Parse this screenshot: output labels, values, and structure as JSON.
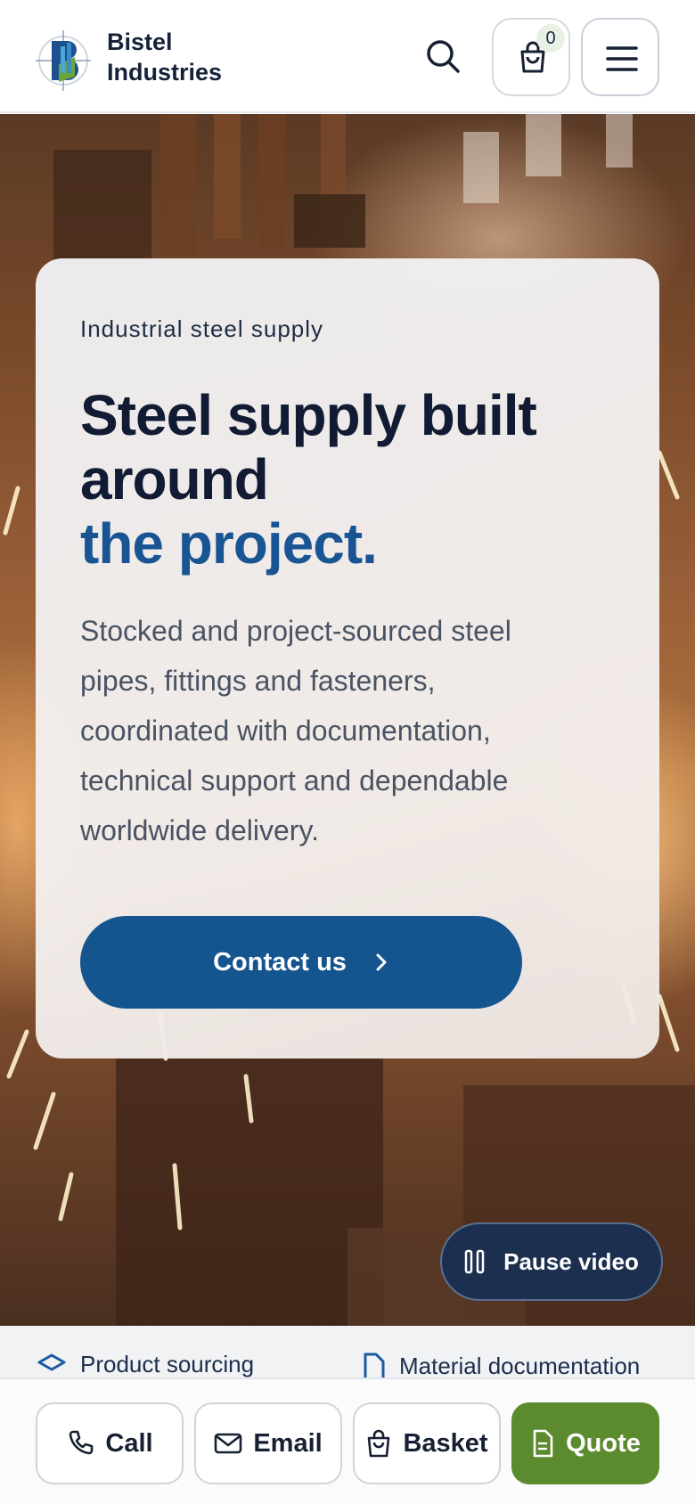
{
  "header": {
    "brand_line1": "Bistel",
    "brand_line2": "Industries",
    "cart_count": "0"
  },
  "hero": {
    "eyebrow": "Industrial steel supply",
    "headline_line1": "Steel supply built",
    "headline_line2": "around",
    "headline_accent": "the project.",
    "description": "Stocked and project-sourced steel pipes, fittings and fasteners, coordinated with documentation, technical support and dependable worldwide delivery.",
    "cta_label": "Contact us",
    "pause_label": "Pause video"
  },
  "strip": {
    "item1": "Product sourcing",
    "item2": "Material documentation"
  },
  "actions": {
    "call": "Call",
    "email": "Email",
    "basket": "Basket",
    "quote": "Quote"
  },
  "colors": {
    "primary": "#14548f",
    "accent_text": "#195493",
    "quote_green": "#5c8a2e",
    "dark_text": "#111b33"
  }
}
